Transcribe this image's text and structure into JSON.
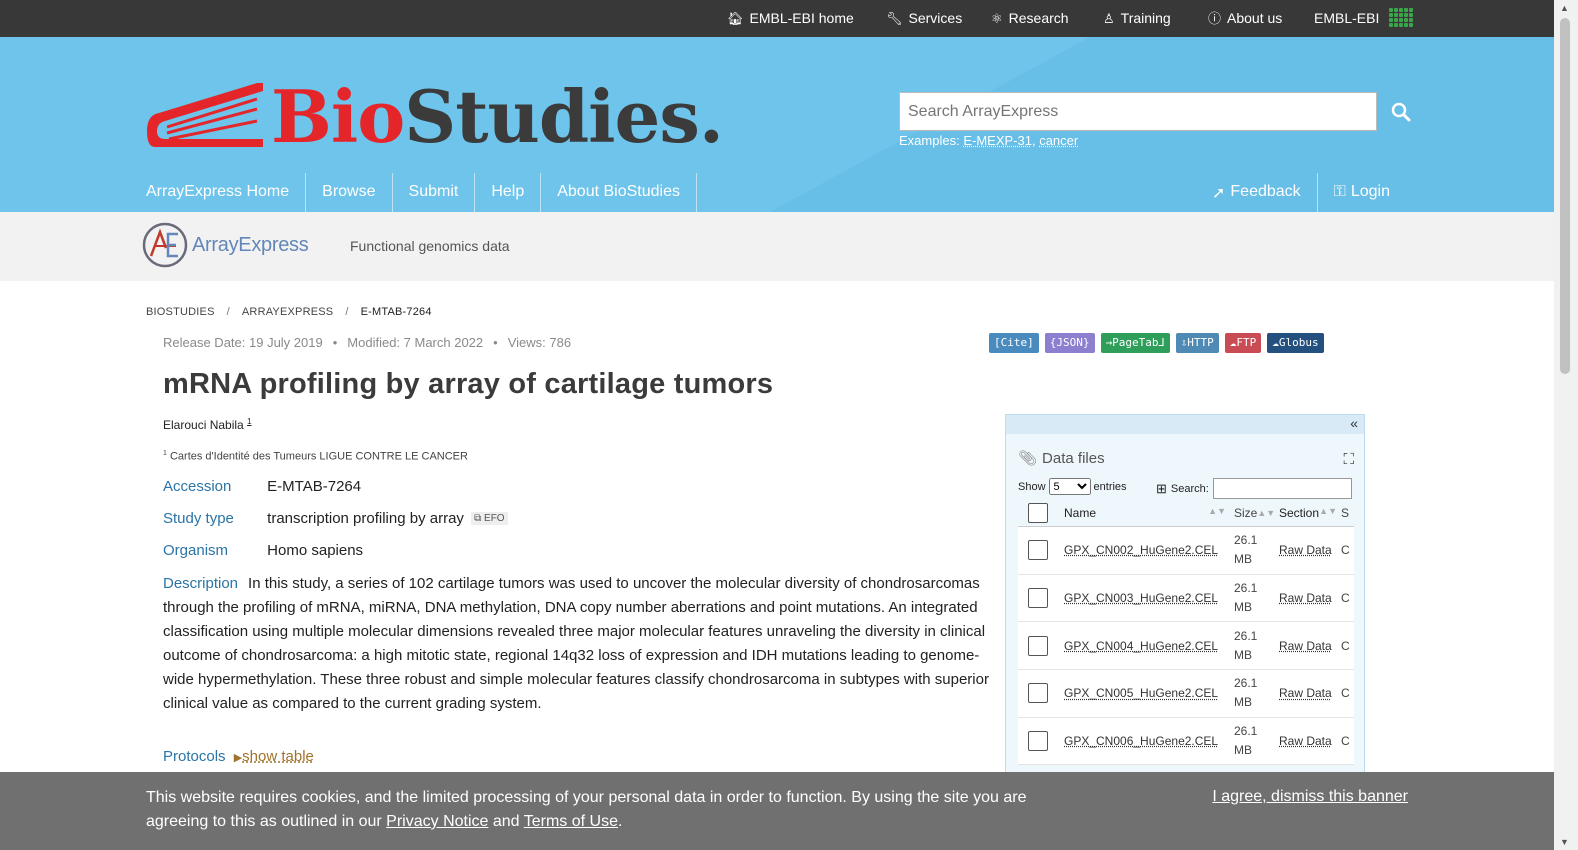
{
  "globalbar": {
    "items": [
      {
        "label": "EMBL-EBI home",
        "icon": "home-icon"
      },
      {
        "label": "Services",
        "icon": "wrench-icon"
      },
      {
        "label": "Research",
        "icon": "research-icon"
      },
      {
        "label": "Training",
        "icon": "training-icon"
      },
      {
        "label": "About us",
        "icon": "info-icon"
      }
    ],
    "brand": "EMBL-EBI"
  },
  "masthead": {
    "logo_bio": "Bio",
    "logo_studies": "Studies.",
    "search_placeholder": "Search ArrayExpress",
    "examples_label": "Examples:",
    "examples": [
      "E-MEXP-31",
      "cancer"
    ],
    "nav": [
      "ArrayExpress Home",
      "Browse",
      "Submit",
      "Help",
      "About BioStudies"
    ],
    "feedback": "Feedback",
    "login": "Login"
  },
  "subheader": {
    "logo_text": "ArrayExpress",
    "tagline": "Functional genomics data"
  },
  "breadcrumb": [
    "BIOSTUDIES",
    "ARRAYEXPRESS",
    "E-MTAB-7264"
  ],
  "meta": {
    "release": "Release Date: 19 July 2019",
    "modified": "Modified: 7 March 2022",
    "views": "Views: 786"
  },
  "badges": [
    {
      "label": "[Cite]",
      "color": "#4a8bbf"
    },
    {
      "label": "{JSON}",
      "color": "#8d7fd0"
    },
    {
      "label": "→PageTab⅃",
      "color": "#2f9e5a"
    },
    {
      "label": "⇩HTTP",
      "color": "#4f8ab5"
    },
    {
      "label": "☁FTP",
      "color": "#c94c55"
    },
    {
      "label": "☁Globus",
      "color": "#23507f"
    }
  ],
  "study": {
    "title": "mRNA profiling by array of cartilage tumors",
    "author": "Elarouci Nabila",
    "author_ref": "1",
    "affiliation": "Cartes d'Identité des Tumeurs LIGUE CONTRE LE CANCER",
    "accession_label": "Accession",
    "accession": "E-MTAB-7264",
    "study_type_label": "Study type",
    "study_type": "transcription profiling by array",
    "efo": "EFO",
    "organism_label": "Organism",
    "organism": "Homo sapiens",
    "description_label": "Description",
    "description": "In this study, a series of 102 cartilage tumors was used to uncover the molecular diversity of chondrosarcomas through the profiling of mRNA, miRNA, DNA methylation, DNA copy number aberrations and point mutations. An integrated classification using multiple molecular dimensions revealed three major molecular features unraveling the diversity in clinical outcome of chondrosarcoma: a high mitotic state, regional 14q32 loss of expression and IDH mutations leading to genome-wide hypermethylation. These three robust and simple molecular features classify chondrosarcoma in subtypes with superior clinical value as compared to the current grading system.",
    "protocols_label": "Protocols",
    "show_table": "show table"
  },
  "datafiles": {
    "title": "Data files",
    "show_label": "Show",
    "show_value": "5",
    "entries_label": "entries",
    "search_label": "Search:",
    "columns": [
      "Name",
      "Size",
      "Section",
      "S"
    ],
    "rows": [
      {
        "name": "GPX_CN002_HuGene2.CEL",
        "size1": "26.1",
        "size2": "MB",
        "section": "Raw Data",
        "s": "C"
      },
      {
        "name": "GPX_CN003_HuGene2.CEL",
        "size1": "26.1",
        "size2": "MB",
        "section": "Raw Data",
        "s": "C"
      },
      {
        "name": "GPX_CN004_HuGene2.CEL",
        "size1": "26.1",
        "size2": "MB",
        "section": "Raw Data",
        "s": "C"
      },
      {
        "name": "GPX_CN005_HuGene2.CEL",
        "size1": "26.1",
        "size2": "MB",
        "section": "Raw Data",
        "s": "C"
      },
      {
        "name": "GPX_CN006_HuGene2.CEL",
        "size1": "26.1",
        "size2": "MB",
        "section": "Raw Data",
        "s": "C"
      }
    ]
  },
  "cookie": {
    "text_1": "This website requires cookies, and the limited processing of your personal data in order to function. By using the site you are agreeing to this as outlined in our",
    "privacy": "Privacy Notice",
    "and": "and",
    "terms": "Terms of Use",
    "dismiss": "I agree, dismiss this banner"
  }
}
